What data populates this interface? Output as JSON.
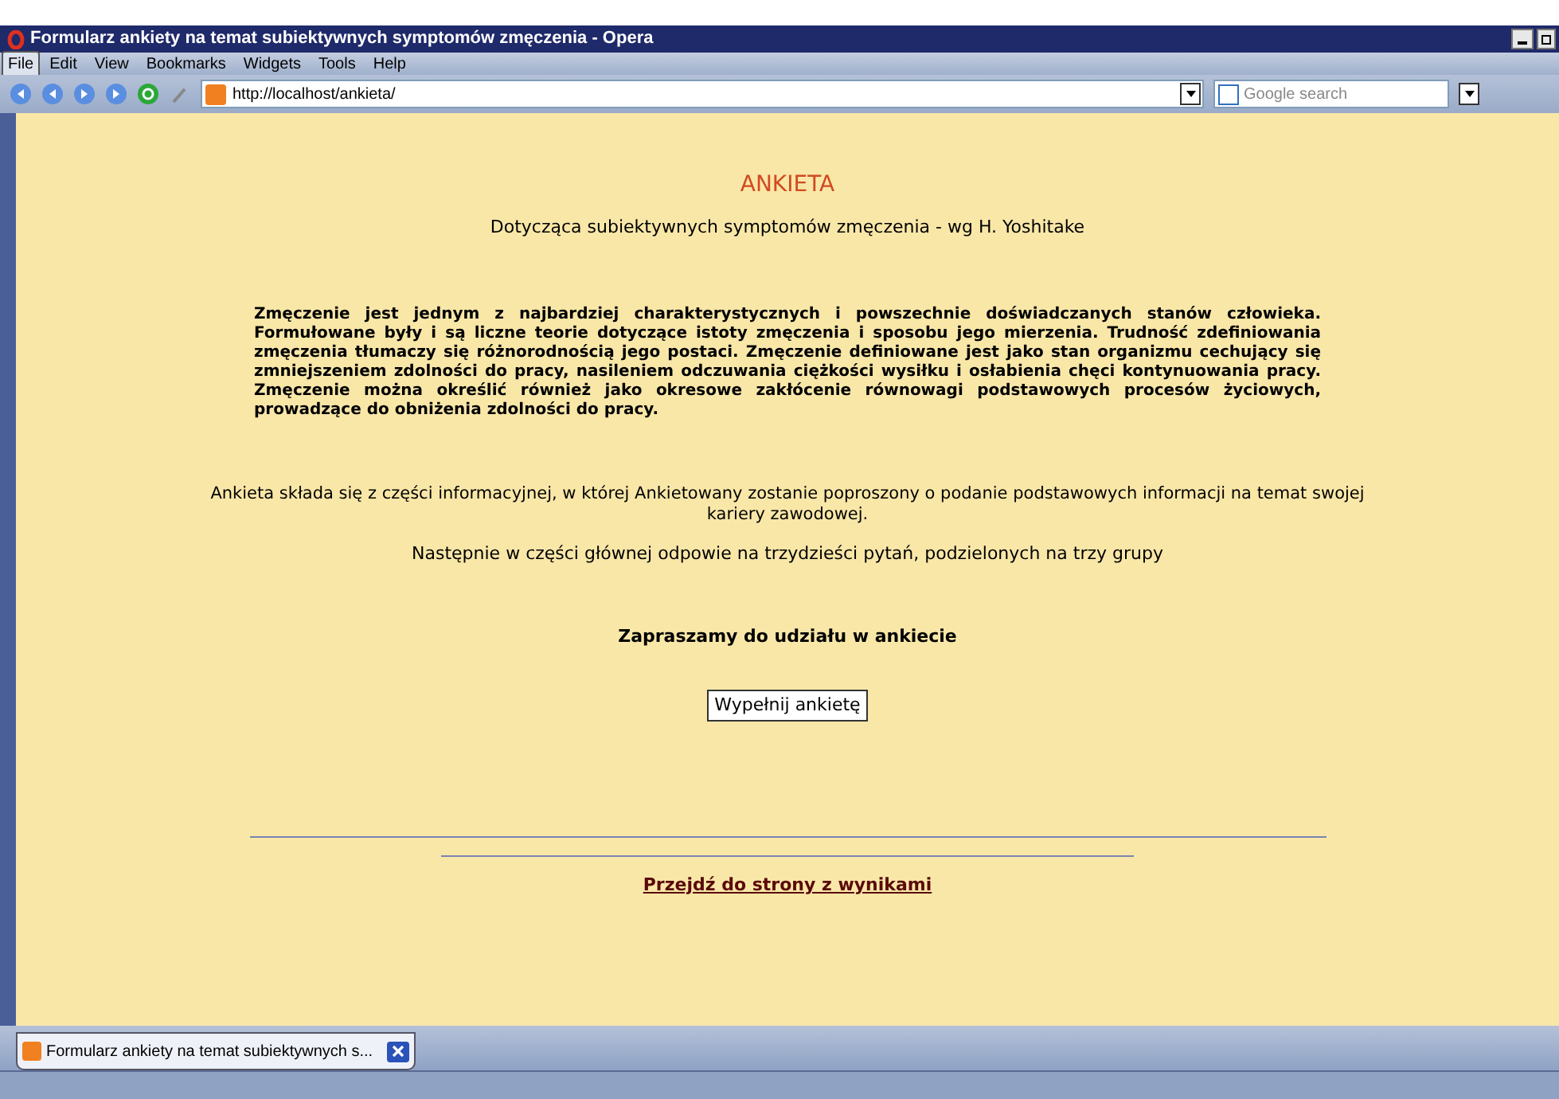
{
  "window": {
    "title": "Formularz ankiety na temat subiektywnych symptomów zmęczenia - Opera"
  },
  "menu": [
    {
      "label": "File",
      "selected": true
    },
    {
      "label": "Edit",
      "selected": false
    },
    {
      "label": "View",
      "selected": false
    },
    {
      "label": "Bookmarks",
      "selected": false
    },
    {
      "label": "Widgets",
      "selected": false
    },
    {
      "label": "Tools",
      "selected": false
    },
    {
      "label": "Help",
      "selected": false
    }
  ],
  "address": {
    "value": "http://localhost/ankieta/"
  },
  "search": {
    "placeholder": "Google search"
  },
  "page": {
    "heading": "ANKIETA",
    "subheading": "Dotycząca subiektywnych symptomów zmęczenia - wg H. Yoshitake",
    "intro": "Zmęczenie jest jednym z najbardziej charakterystycznych i powszechnie doświadczanych stanów człowieka. Formułowane były i są liczne teorie dotyczące istoty zmęczenia i sposobu jego mierzenia. Trudność zdefiniowania zmęczenia tłumaczy się różnorodnością jego postaci. Zmęczenie definiowane jest jako stan organizmu cechujący się zmniejszeniem zdolności do pracy, nasileniem odczuwania ciężkości wysiłku i osłabienia chęci kontynuowania pracy. Zmęczenie można określić również jako okresowe zakłócenie równowagi podstawowych procesów życiowych, prowadzące do obniżenia zdolności do pracy.",
    "info": [
      "Ankieta składa się z części informacyjnej, w której Ankietowany zostanie poproszony o podanie podstawowych informacji na temat swojej kariery zawodowej.",
      "Następnie w części głównej odpowie na trzydzieści pytań, podzielonych na trzy grupy"
    ],
    "invite": "Zapraszamy do udziału w ankiecie",
    "button": "Wypełnij ankietę",
    "results_link": "Przejdź do strony z wynikami"
  },
  "tabs": [
    {
      "label": "Formularz ankiety na temat subiektywnych s...",
      "selected": true
    }
  ]
}
